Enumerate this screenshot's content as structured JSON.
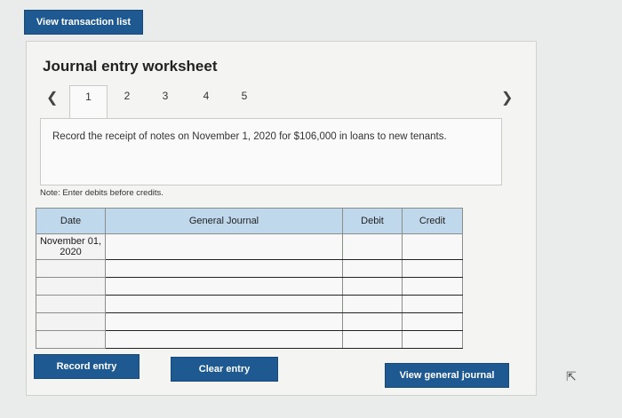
{
  "header": {
    "view_transactions_label": "View transaction list"
  },
  "worksheet": {
    "title": "Journal entry worksheet",
    "tabs": [
      {
        "label": "1",
        "active": true
      },
      {
        "label": "2",
        "active": false
      },
      {
        "label": "3",
        "active": false
      },
      {
        "label": "4",
        "active": false
      },
      {
        "label": "5",
        "active": false
      }
    ],
    "prev_icon": "chevron-left-icon",
    "next_icon": "chevron-right-icon",
    "instruction": "Record the receipt of notes on November 1, 2020 for $106,000 in loans to new tenants.",
    "note": "Note: Enter debits before credits."
  },
  "table": {
    "headers": {
      "date": "Date",
      "journal": "General Journal",
      "debit": "Debit",
      "credit": "Credit"
    },
    "rows": [
      {
        "date": "November 01, 2020",
        "account": "",
        "debit": "",
        "credit": ""
      },
      {
        "date": "",
        "account": "",
        "debit": "",
        "credit": ""
      },
      {
        "date": "",
        "account": "",
        "debit": "",
        "credit": ""
      },
      {
        "date": "",
        "account": "",
        "debit": "",
        "credit": ""
      },
      {
        "date": "",
        "account": "",
        "debit": "",
        "credit": ""
      },
      {
        "date": "",
        "account": "",
        "debit": "",
        "credit": ""
      }
    ]
  },
  "buttons": {
    "record": "Record entry",
    "clear": "Clear entry",
    "view_general_journal": "View general journal"
  },
  "colors": {
    "button": "#1e5a91",
    "table_header": "#bfd8ec"
  }
}
